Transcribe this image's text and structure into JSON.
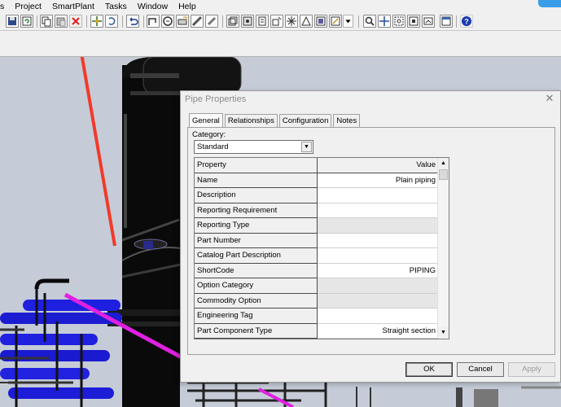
{
  "menu": [
    "s",
    "Project",
    "SmartPlant",
    "Tasks",
    "Window",
    "Help"
  ],
  "toolbar_icons": [
    "save-icon",
    "refresh-icon",
    "copy-icon",
    "paste-icon",
    "delete-x-icon",
    "move-icon",
    "rotate-icon",
    "undo-icon",
    "route-icon",
    "tool-icon",
    "insert-icon",
    "measure-icon",
    "view-icon",
    "view2-icon",
    "view3-icon",
    "view4-icon",
    "view5-icon",
    "view6-icon",
    "view7-icon",
    "dropdown-icon",
    "zoom-icon",
    "pan-icon",
    "zoom-area-icon",
    "fit-icon",
    "snapshot-icon",
    "frame-icon",
    "help-icon"
  ],
  "colors": {
    "delete_x": "#e02020",
    "arrow": "#f23a2a",
    "pipe_blue": "#1f1fe0",
    "pipe_magenta": "#e020e0",
    "viewport_bg": "#c5ccd8"
  },
  "dialog": {
    "title": "Pipe Properties",
    "close_glyph": "✕",
    "tabs": [
      "General",
      "Relationships",
      "Configuration",
      "Notes"
    ],
    "active_tab": "General",
    "category_label": "Category:",
    "category_value": "Standard",
    "grid_header": {
      "property": "Property",
      "value": "Value"
    },
    "rows": [
      {
        "property": "Name",
        "value": "Plain piping",
        "readonly": false
      },
      {
        "property": "Description",
        "value": "",
        "readonly": false
      },
      {
        "property": "Reporting Requirement",
        "value": "",
        "readonly": false
      },
      {
        "property": "Reporting Type",
        "value": "",
        "readonly": true
      },
      {
        "property": "Part Number",
        "value": "",
        "readonly": false
      },
      {
        "property": "Catalog Part Description",
        "value": "",
        "readonly": false
      },
      {
        "property": "ShortCode",
        "value": "PIPING",
        "readonly": false
      },
      {
        "property": "Option Category",
        "value": "",
        "readonly": true
      },
      {
        "property": "Commodity Option",
        "value": "",
        "readonly": true
      },
      {
        "property": "Engineering Tag",
        "value": "",
        "readonly": false
      },
      {
        "property": "Part Component Type",
        "value": "Straight section",
        "readonly": false
      }
    ],
    "buttons": {
      "ok": "OK",
      "cancel": "Cancel",
      "apply": "Apply"
    }
  }
}
